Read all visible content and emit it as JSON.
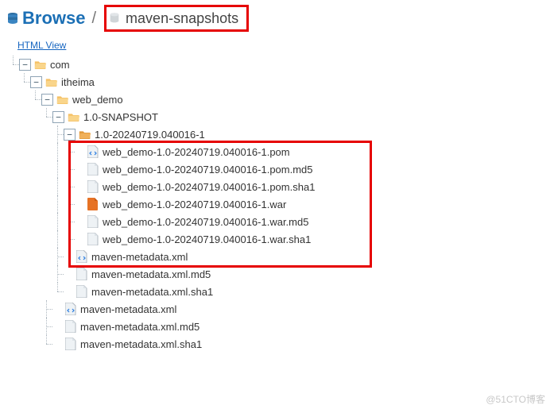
{
  "header": {
    "browse_title": "Browse",
    "separator": "/",
    "repo_name": "maven-snapshots"
  },
  "html_view_label": "HTML View",
  "tree": {
    "com": "com",
    "itheima": "itheima",
    "web_demo": "web_demo",
    "snapshot": "1.0-SNAPSHOT",
    "build": "1.0-20240719.040016-1",
    "files_build": [
      "web_demo-1.0-20240719.040016-1.pom",
      "web_demo-1.0-20240719.040016-1.pom.md5",
      "web_demo-1.0-20240719.040016-1.pom.sha1",
      "web_demo-1.0-20240719.040016-1.war",
      "web_demo-1.0-20240719.040016-1.war.md5",
      "web_demo-1.0-20240719.040016-1.war.sha1"
    ],
    "files_snapshot": [
      "maven-metadata.xml",
      "maven-metadata.xml.md5",
      "maven-metadata.xml.sha1"
    ],
    "files_web_demo": [
      "maven-metadata.xml",
      "maven-metadata.xml.md5",
      "maven-metadata.xml.sha1"
    ]
  },
  "file_icons": {
    "web_demo-1.0-20240719.040016-1.pom": "xml",
    "web_demo-1.0-20240719.040016-1.pom.md5": "generic",
    "web_demo-1.0-20240719.040016-1.pom.sha1": "generic",
    "web_demo-1.0-20240719.040016-1.war": "war",
    "web_demo-1.0-20240719.040016-1.war.md5": "generic",
    "web_demo-1.0-20240719.040016-1.war.sha1": "generic",
    "maven-metadata.xml": "xml",
    "maven-metadata.xml.md5": "generic",
    "maven-metadata.xml.sha1": "generic"
  },
  "watermark": "@51CTO博客"
}
